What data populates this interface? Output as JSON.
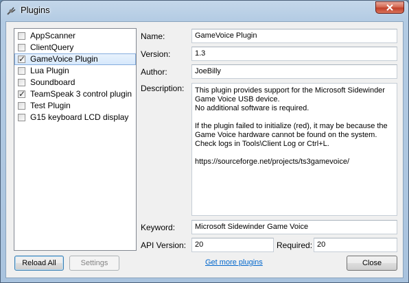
{
  "window": {
    "title": "Plugins"
  },
  "plugins": [
    {
      "label": "AppScanner",
      "checked": false,
      "selected": false
    },
    {
      "label": "ClientQuery",
      "checked": false,
      "selected": false
    },
    {
      "label": "GameVoice Plugin",
      "checked": true,
      "selected": true
    },
    {
      "label": "Lua Plugin",
      "checked": false,
      "selected": false
    },
    {
      "label": "Soundboard",
      "checked": false,
      "selected": false
    },
    {
      "label": "TeamSpeak 3 control plugin",
      "checked": true,
      "selected": false
    },
    {
      "label": "Test Plugin",
      "checked": false,
      "selected": false
    },
    {
      "label": "G15 keyboard LCD display",
      "checked": false,
      "selected": false
    }
  ],
  "details": {
    "name_label": "Name:",
    "name_value": "GameVoice Plugin",
    "version_label": "Version:",
    "version_value": "1.3",
    "author_label": "Author:",
    "author_value": "JoeBilly",
    "description_label": "Description:",
    "description_lines": [
      "This plugin provides support for the Microsoft Sidewinder",
      "Game Voice USB device.",
      "No additional software is required.",
      "",
      "If the plugin failed to initialize (red), it may be because the",
      "Game Voice hardware cannot be found on the system.",
      "Check logs in Tools\\Client Log or Ctrl+L.",
      "",
      "https://sourceforge.net/projects/ts3gamevoice/"
    ],
    "keyword_label": "Keyword:",
    "keyword_value": "Microsoft Sidewinder Game Voice",
    "api_version_label": "API Version:",
    "api_version_value": "20",
    "required_label": "Required:",
    "required_value": "20"
  },
  "buttons": {
    "reload_all": "Reload All",
    "settings": "Settings",
    "get_more_plugins": "Get more plugins",
    "close": "Close"
  }
}
